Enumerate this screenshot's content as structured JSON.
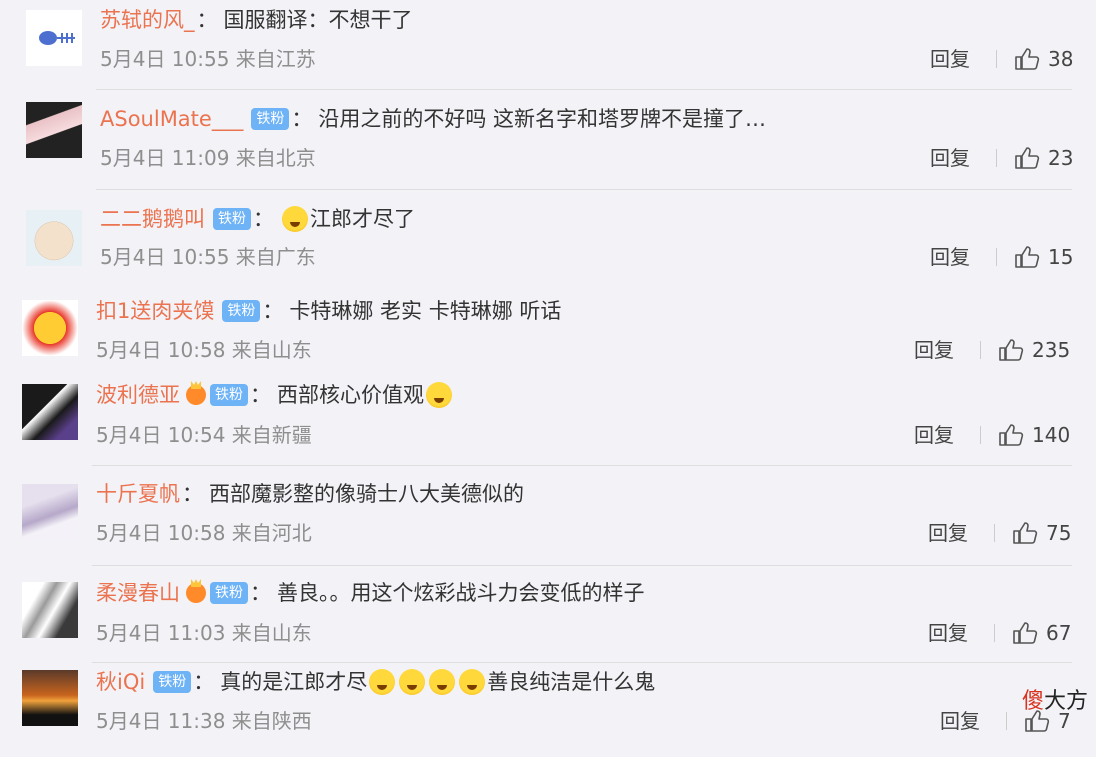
{
  "reply_label": "回复",
  "comments": [
    {
      "user": "苏轼的风_",
      "badge": "",
      "crown": false,
      "text_before": "国服翻译：不想干了",
      "emoji_count": 0,
      "text_after": "",
      "time": "5月4日 10:55 来自江苏",
      "likes": "38"
    },
    {
      "user": "ASoulMate___",
      "badge": "铁粉",
      "crown": false,
      "text_before": "沿用之前的不好吗 这新名字和塔罗牌不是撞了…",
      "emoji_count": 0,
      "text_after": "",
      "time": "5月4日 11:09 来自北京",
      "likes": "23"
    },
    {
      "user": "二二鹅鹅叫",
      "badge": "铁粉",
      "crown": false,
      "text_before": "",
      "emoji_count": 1,
      "text_after": "江郎才尽了",
      "time": "5月4日 10:55 来自广东",
      "likes": "15"
    },
    {
      "user": "扣1送肉夹馍",
      "badge": "铁粉",
      "crown": false,
      "text_before": "卡特琳娜 老实 卡特琳娜 听话",
      "emoji_count": 0,
      "text_after": "",
      "time": "5月4日 10:58 来自山东",
      "likes": "235"
    },
    {
      "user": "波利德亚",
      "badge": "铁粉",
      "crown": true,
      "text_before": "西部核心价值观",
      "emoji_count": 1,
      "text_after": "",
      "time": "5月4日 10:54 来自新疆",
      "likes": "140"
    },
    {
      "user": "十斤夏帆",
      "badge": "",
      "crown": false,
      "text_before": "西部魔影整的像骑士八大美德似的",
      "emoji_count": 0,
      "text_after": "",
      "time": "5月4日 10:58 来自河北",
      "likes": "75"
    },
    {
      "user": "柔漫春山",
      "badge": "铁粉",
      "crown": true,
      "text_before": "善良。。用这个炫彩战斗力会变低的样子",
      "emoji_count": 0,
      "text_after": "",
      "time": "5月4日 11:03 来自山东",
      "likes": "67"
    },
    {
      "user": "秋iQi",
      "badge": "铁粉",
      "crown": false,
      "text_before": "真的是江郎才尽",
      "emoji_count": 4,
      "text_after": "善良纯洁是什么鬼",
      "time": "5月4日 11:38 来自陕西",
      "likes": "7"
    }
  ],
  "watermark": {
    "red": "傻",
    "black": "大方"
  }
}
